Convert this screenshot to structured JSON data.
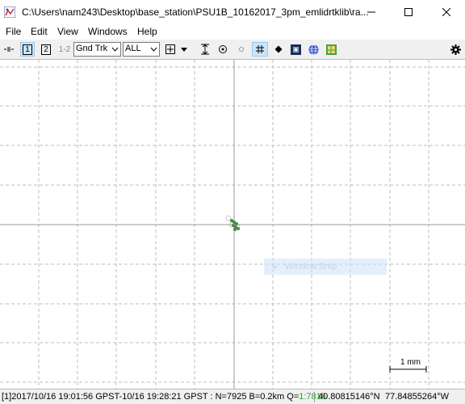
{
  "window": {
    "title": "C:\\Users\\nam243\\Desktop\\base_station\\PSU1B_10162017_3pm_emlidrtklib\\ra..."
  },
  "menu": [
    "File",
    "Edit",
    "View",
    "Windows",
    "Help"
  ],
  "toolbar": {
    "btn1": "1",
    "btn2": "2",
    "btn12": "1-2",
    "plot_type": "Gnd Trk",
    "sat_filter": "ALL"
  },
  "snip_overlay": {
    "label": "Window Snip"
  },
  "scale": {
    "label": "1 mm"
  },
  "status": {
    "info_prefix": "[1]2017/10/16 19:01:56 GPST-10/16 19:28:21 GPST : N=7925 B=0.2km Q=",
    "q_value": "1:7816",
    "lat": "40.80815146°N",
    "lon": "77.84855264°W"
  },
  "colors": {
    "grid": "#bdbdbd",
    "axis": "#9a9a9a",
    "fix_green": "#2aa52a",
    "selected_bg": "#cce4f7"
  }
}
